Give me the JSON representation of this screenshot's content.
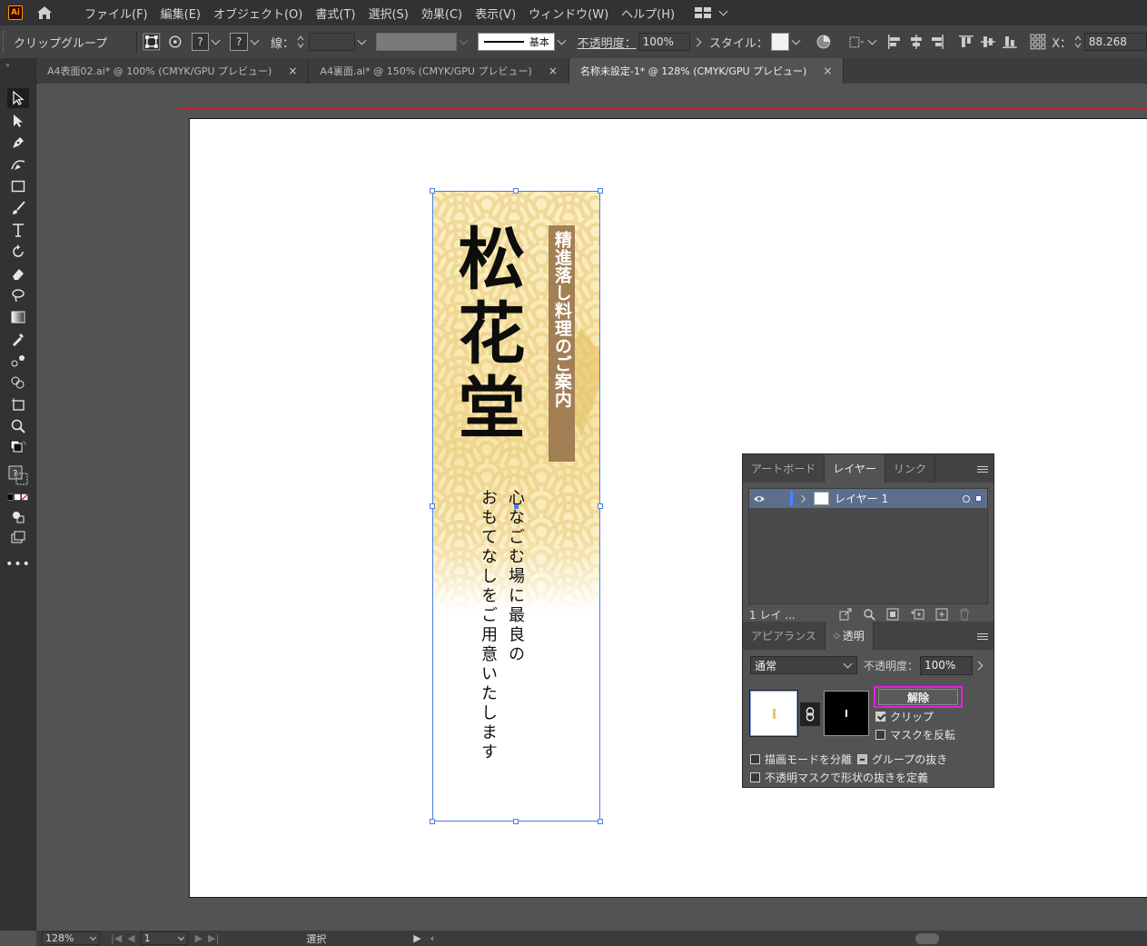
{
  "app": {
    "logo_text": "Ai"
  },
  "menubar": {
    "items": [
      "ファイル(F)",
      "編集(E)",
      "オブジェクト(O)",
      "書式(T)",
      "選択(S)",
      "効果(C)",
      "表示(V)",
      "ウィンドウ(W)",
      "ヘルプ(H)"
    ]
  },
  "controlbar": {
    "selection_label": "クリップグループ",
    "stroke_label": "線：",
    "stroke_style": "基本",
    "opacity_label": "不透明度：",
    "opacity_value": "100%",
    "style_label": "スタイル：",
    "x_label": "X：",
    "x_value": "88.268"
  },
  "tabs": [
    {
      "label": "A4表面02.ai* @ 100% (CMYK/GPU プレビュー)",
      "close": "×"
    },
    {
      "label": "A4裏面.ai* @ 150% (CMYK/GPU プレビュー)",
      "close": "×"
    },
    {
      "label": "名称未設定-1* @ 128% (CMYK/GPU プレビュー)",
      "close": "×",
      "active": true
    }
  ],
  "banner": {
    "title": "松花堂",
    "subtitle": "精進落し料理のご案内",
    "tagline_line1": "心なごむ場に最良の",
    "tagline_line2": "おもてなしをご用意いたします"
  },
  "layers_panel": {
    "tabs": [
      "アートボード",
      "レイヤー",
      "リンク"
    ],
    "active_tab": "レイヤー",
    "layer_name": "レイヤー 1",
    "footer_label": "1 レイ ..."
  },
  "transparency_panel": {
    "tabs": [
      "アピアランス",
      "透明"
    ],
    "active_tab": "透明",
    "blend_mode": "通常",
    "opacity_label": "不透明度：",
    "opacity_value": "100%",
    "release_button": "解除",
    "clip_label": "クリップ",
    "clip_checked": true,
    "invert_mask_label": "マスクを反転",
    "invert_mask_checked": false,
    "isolate_blending_label": "描画モードを分離",
    "knockout_group_label": "グループの抜き",
    "opacity_mask_knockout_label": "不透明マスクで形状の抜きを定義"
  },
  "statusbar": {
    "zoom": "128%",
    "artboard_number": "1",
    "tool_name": "選択"
  },
  "colors": {
    "highlight_frame": "#e020e0",
    "selection_blue": "#4a7fe0",
    "bleed_red": "#cc2222",
    "subtitle_bg": "#a37f55",
    "banner_gold": "#f7e4a6"
  }
}
